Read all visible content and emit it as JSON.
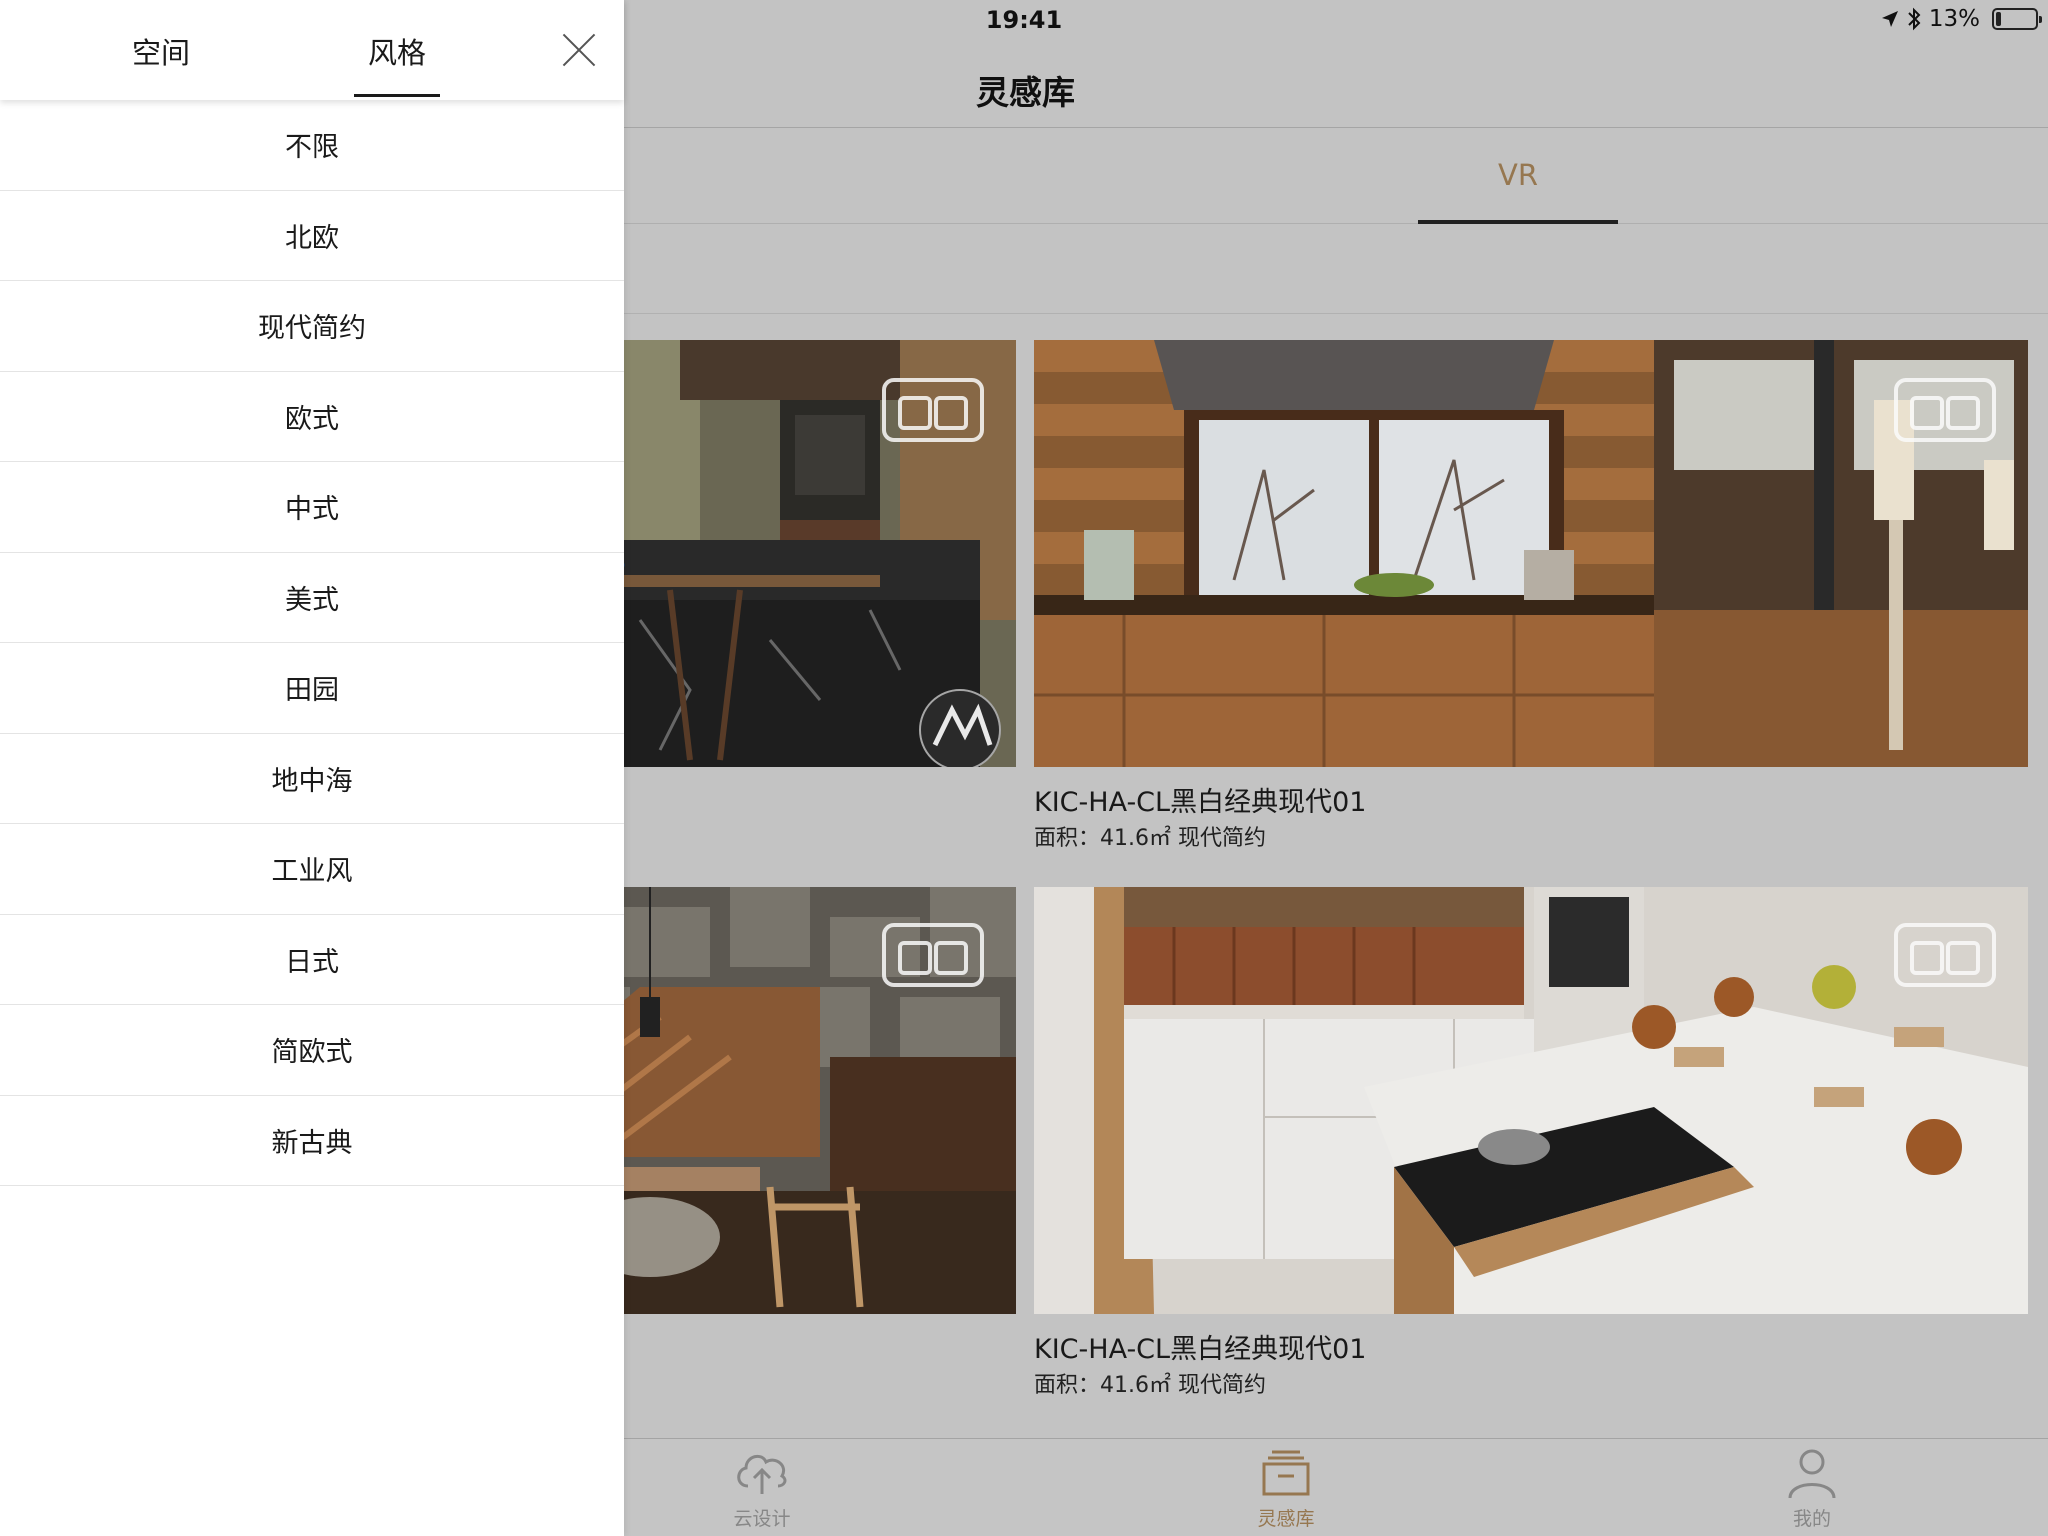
{
  "status_bar": {
    "time": "19:41",
    "battery": "13%",
    "battery_level": 0.13
  },
  "nav": {
    "title": "灵感库"
  },
  "top_tabs": {
    "active": "VR"
  },
  "cards": [
    {
      "title": "",
      "meta": "",
      "img_theme": "dark-marble-kitchen",
      "has_vr": true
    },
    {
      "title": "KIC-HA-CL黑白经典现代01",
      "meta": "面积：41.6㎡ 现代简约",
      "img_theme": "wood-kitchen",
      "has_vr": true
    },
    {
      "title": "",
      "meta": "",
      "img_theme": "stone-dining",
      "has_vr": true
    },
    {
      "title": "KIC-HA-CL黑白经典现代01",
      "meta": "面积：41.6㎡ 现代简约",
      "img_theme": "white-kitchen",
      "has_vr": true
    }
  ],
  "bottom_tabs": [
    {
      "label": "云设计",
      "icon": "cloud-upload-icon",
      "active": false
    },
    {
      "label": "灵感库",
      "icon": "inspiration-library-icon",
      "active": true
    },
    {
      "label": "我的",
      "icon": "user-icon",
      "active": false
    }
  ],
  "drawer": {
    "tabs": [
      {
        "label": "空间",
        "active": false
      },
      {
        "label": "风格",
        "active": true
      }
    ],
    "close_icon": "close-icon",
    "items": [
      "不限",
      "北欧",
      "现代简约",
      "欧式",
      "中式",
      "美式",
      "田园",
      "地中海",
      "工业风",
      "日式",
      "简欧式",
      "新古典"
    ]
  },
  "colors": {
    "accent": "#9a7a52",
    "background": "#c7c7c7",
    "drawer_bg": "#ffffff"
  }
}
